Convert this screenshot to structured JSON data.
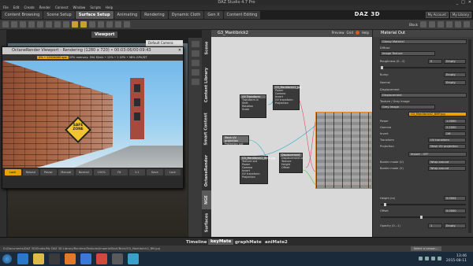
{
  "window": {
    "title": "DAZ Studio 4.7 Pro",
    "controls": [
      "_",
      "□",
      "✕"
    ]
  },
  "menu": [
    "File",
    "Edit",
    "Create",
    "Render",
    "Connect",
    "Window",
    "Scripts",
    "Help"
  ],
  "room_tabs": [
    {
      "label": "Content Browsing",
      "active": false
    },
    {
      "label": "Scene Setup",
      "active": false
    },
    {
      "label": "Surface Setup",
      "active": true
    },
    {
      "label": "Animating",
      "active": false
    },
    {
      "label": "Rendering",
      "active": false
    },
    {
      "label": "Dynamic Cloth",
      "active": false
    },
    {
      "label": "Gen X",
      "active": false
    },
    {
      "label": "Content Editing",
      "active": false
    }
  ],
  "brand": "DAZ 3D",
  "account_links": [
    "My Account",
    "My Library"
  ],
  "toolbar": {
    "mode_label": "Block"
  },
  "viewport": {
    "tab_label": "Viewport",
    "camera": "Default Camera"
  },
  "octane": {
    "title": "OctaneRender Viewport - Rendering (1280 x 720) • 00:03:06/00:09:43",
    "stat_highlight": "3% • 12024000 sps",
    "stat_text": "GPU memory: 594 M/mk • 12% • 1 GPU • 98% GPU/DT",
    "sign_text": "SAFE ZONE",
    "buttons": [
      {
        "label": "Lock",
        "active": true
      },
      {
        "label": "Reload",
        "active": false
      },
      {
        "label": "Pause",
        "active": false
      },
      {
        "label": "Manual",
        "active": false
      },
      {
        "label": "Normal",
        "active": false
      },
      {
        "label": "100%",
        "active": false
      },
      {
        "label": "Fit",
        "active": false
      },
      {
        "label": "1:1",
        "active": false
      },
      {
        "label": "Save",
        "active": false
      },
      {
        "label": "Lock",
        "active": false
      }
    ]
  },
  "side_tabs": [
    "Scene",
    "Smart Content",
    "Content Library",
    "OctaneRender",
    "NGE",
    "Surfaces"
  ],
  "graph": {
    "title": "G3_Mantibrick2",
    "options": [
      "Preview",
      "Grid",
      "Help"
    ],
    "nodes": [
      {
        "title": "G3_Mantibrick2_Jpg",
        "rows": [
          "Power",
          "Gamma",
          "Invert",
          "UV transform",
          "Projection"
        ]
      },
      {
        "title": "UV Transform",
        "rows": [
          "Transform.in",
          "Shift",
          "Rotation",
          "Scale"
        ]
      },
      {
        "title": "Mesh UV projection",
        "rows": [
          "Projection out"
        ]
      },
      {
        "title": "G3_Mantibrick2_Bmp.jpg",
        "rows": [
          "Texture out",
          "Power",
          "Gamma",
          "Invert",
          "UV transform",
          "Projection"
        ]
      },
      {
        "title": "Displacement",
        "rows": [
          "Displacement out",
          "Texture",
          "Height",
          "Offset"
        ]
      }
    ]
  },
  "material": {
    "header": "Material Out",
    "type": "Glossy Material",
    "rows": [
      {
        "label": "Diffuse",
        "value": "Image Texture"
      },
      {
        "label": "Roughness (0...1)",
        "value": "0"
      },
      {
        "label": "Bump",
        "value": "Empty"
      },
      {
        "label": "Normal",
        "value": "Empty"
      },
      {
        "label": "Displacement",
        "value": "Displacement"
      },
      {
        "label": "Texture / Grey Image",
        "value": "Grey Image"
      },
      {
        "label": "",
        "value": "G3_Mantibrick2_BMP.jpg"
      },
      {
        "label": "Power",
        "value": "1.0000"
      },
      {
        "label": "Gamma",
        "value": "2.2000"
      },
      {
        "label": "Invert",
        "value": "Off"
      },
      {
        "label": "Transform",
        "value": "UV transform"
      },
      {
        "label": "Projection",
        "value": "Mesh UV projection"
      },
      {
        "label": "Import / Export",
        "value": "Import - OFF"
      },
      {
        "label": "Border mode (U)",
        "value": "Wrap around"
      },
      {
        "label": "Border mode (V)",
        "value": "Wrap around"
      },
      {
        "label": "Height (m)",
        "value": "0.0004"
      },
      {
        "label": "Offset",
        "value": "0.0000"
      },
      {
        "label": "Opacity (0...1)",
        "value": "1"
      }
    ],
    "empty_label": "Empty"
  },
  "bottom_tabs": [
    {
      "label": "Timeline",
      "active": false
    },
    {
      "label": "keyMate",
      "active": true
    },
    {
      "label": "graphMate",
      "active": false
    },
    {
      "label": "aniMate2",
      "active": false
    }
  ],
  "status": {
    "path": "D:/Documents/DAZ 3D/Studio/My DAZ 3D Library/Runtime/Textures/ImperialSkull/Brick/G3_Mantibrick2_BM.jpg",
    "lesson": "Select a Lesson..."
  },
  "taskbar": {
    "time": "13:46",
    "date": "2015-08-11"
  }
}
